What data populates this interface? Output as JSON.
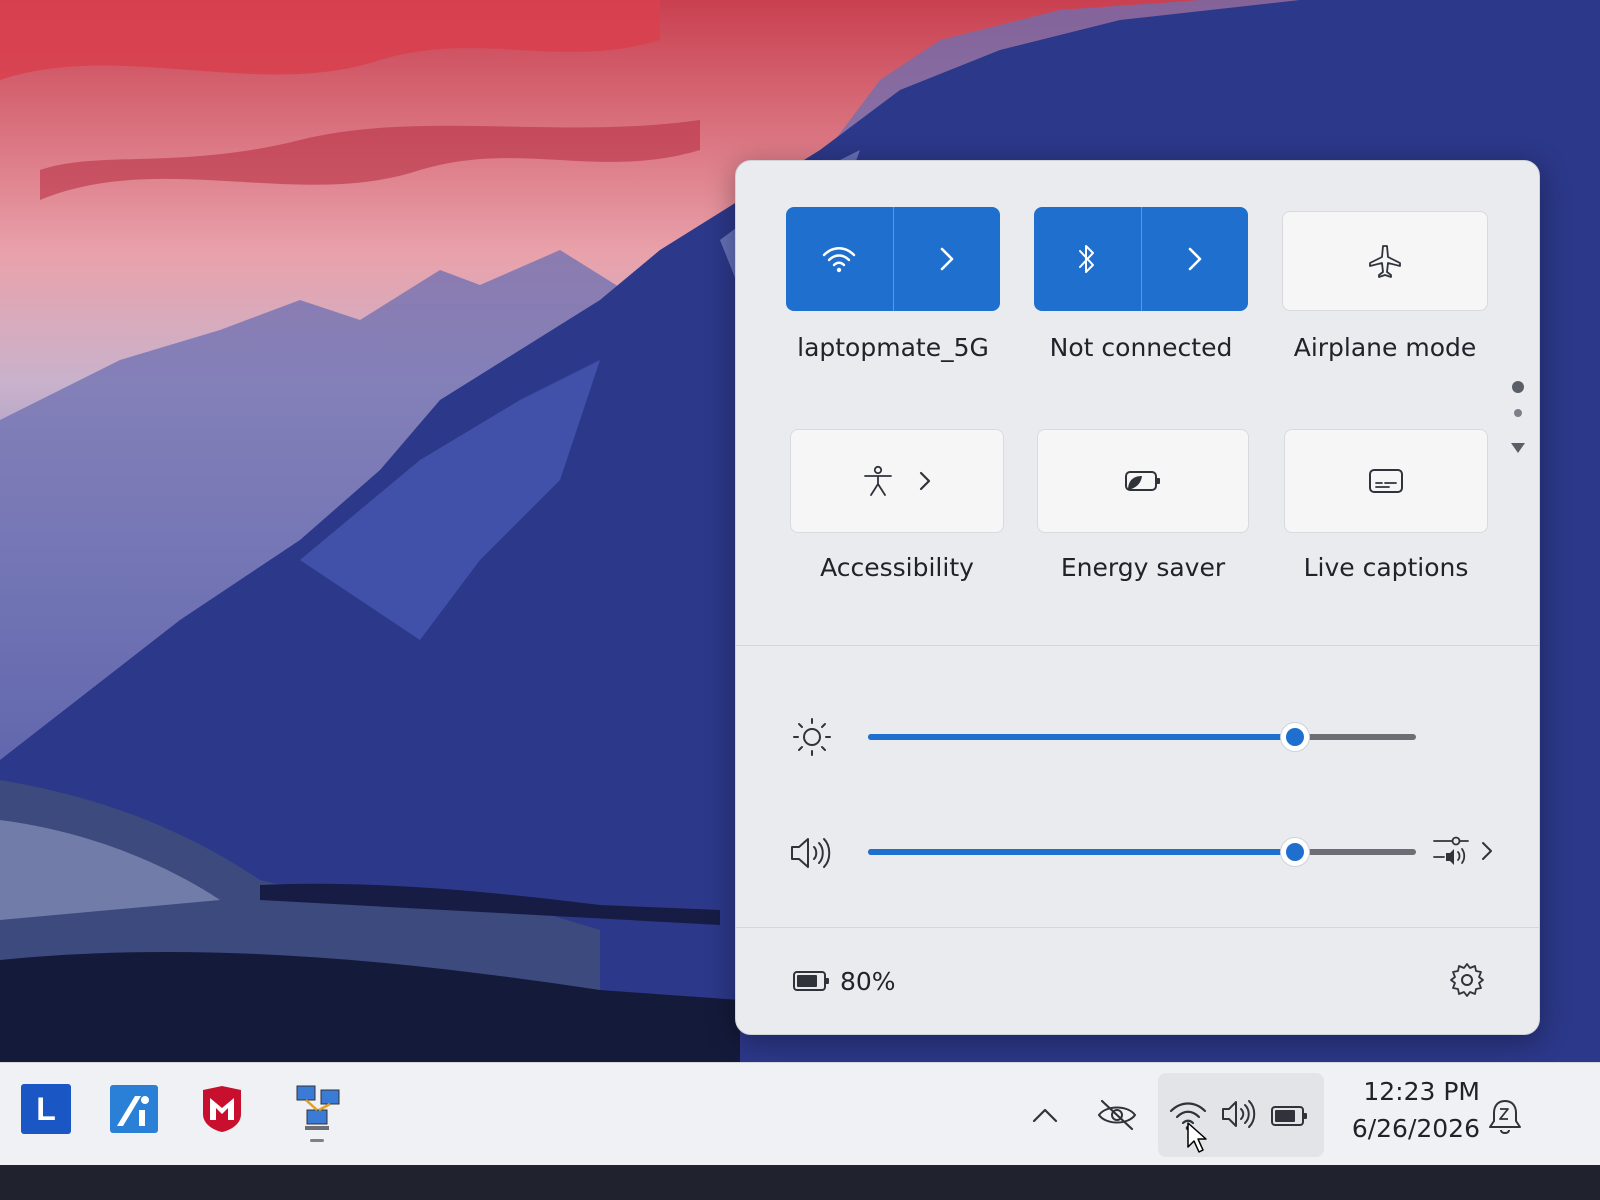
{
  "quick_settings": {
    "tiles": [
      {
        "id": "wifi",
        "label": "laptopmate_5G",
        "state": "on",
        "icon": "wifi-icon",
        "has_chevron": true
      },
      {
        "id": "bluetooth",
        "label": "Not connected",
        "state": "on",
        "icon": "bluetooth-icon",
        "has_chevron": true
      },
      {
        "id": "airplane",
        "label": "Airplane mode",
        "state": "off",
        "icon": "airplane-icon",
        "has_chevron": false
      },
      {
        "id": "accessibility",
        "label": "Accessibility",
        "state": "off",
        "icon": "accessibility-icon",
        "has_chevron": true
      },
      {
        "id": "energy",
        "label": "Energy saver",
        "state": "off",
        "icon": "energy-saver-icon",
        "has_chevron": false
      },
      {
        "id": "captions",
        "label": "Live captions",
        "state": "off",
        "icon": "live-captions-icon",
        "has_chevron": false
      }
    ],
    "brightness": {
      "icon": "brightness-icon",
      "level": 0.78
    },
    "volume": {
      "icon": "speaker-icon",
      "level": 0.78,
      "output_icon": "audio-output-icon"
    },
    "battery": {
      "icon": "battery-icon",
      "percent_text": "80%"
    },
    "settings_icon": "gear-icon"
  },
  "taskbar": {
    "apps": [
      {
        "name": "lenovo-app-icon",
        "letter": "L",
        "color": "#1a56c4"
      },
      {
        "name": "intel-app-icon",
        "color": "#2a7fd6"
      },
      {
        "name": "mcafee-app-icon",
        "color": "#c8102e"
      },
      {
        "name": "network-app-icon"
      }
    ],
    "tray": {
      "overflow_icon": "chevron-up-icon",
      "hidden_icon": "eye-off-icon",
      "wifi_icon": "wifi-icon",
      "volume_icon": "speaker-icon",
      "battery_icon": "battery-icon"
    },
    "clock": {
      "time": "12:23 PM",
      "date": "6/26/2026"
    },
    "notification_icon": "notification-icon"
  },
  "colors": {
    "accent": "#1f6fcf",
    "flyout_bg": "#e9ebef",
    "taskbar_bg": "#f0f1f4"
  }
}
